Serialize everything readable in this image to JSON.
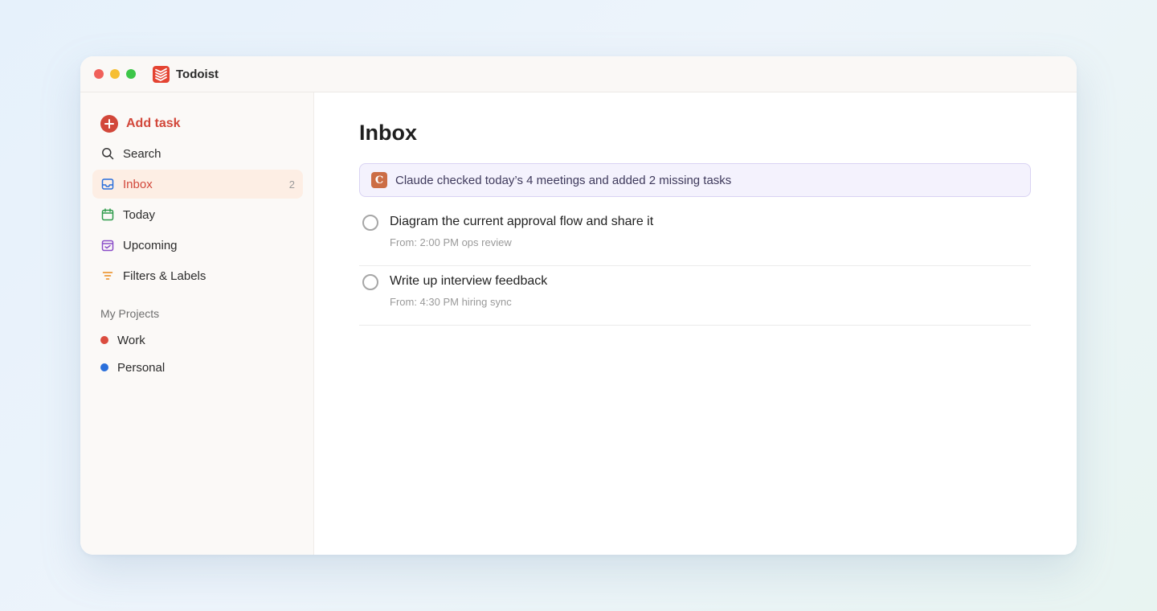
{
  "window": {
    "app_name": "Todoist",
    "colors": {
      "accent": "#d2473a",
      "traffic_red": "#f0605a",
      "traffic_yellow": "#f6be33",
      "traffic_green": "#3cc648"
    }
  },
  "sidebar": {
    "add_task": {
      "label": "Add task",
      "icon": "plus-circle-icon"
    },
    "items": [
      {
        "label": "Search",
        "icon": "search-icon"
      },
      {
        "label": "Inbox",
        "icon": "inbox-icon",
        "count": "2",
        "active": true
      },
      {
        "label": "Today",
        "icon": "calendar-icon"
      },
      {
        "label": "Upcoming",
        "icon": "calendar-upcoming-icon"
      },
      {
        "label": "Filters & Labels",
        "icon": "filter-icon"
      }
    ],
    "projects_heading": "My Projects",
    "projects": [
      {
        "label": "Work",
        "color": "#db4c3f"
      },
      {
        "label": "Personal",
        "color": "#2a6fdb"
      }
    ]
  },
  "main": {
    "title": "Inbox",
    "banner": {
      "badge": "C",
      "text": "Claude checked today’s 4 meetings and added 2 missing tasks"
    },
    "tasks": [
      {
        "title": "Diagram the current approval flow and share it",
        "meta": "From: 2:00 PM ops review"
      },
      {
        "title": "Write up interview feedback",
        "meta": "From: 4:30 PM hiring sync"
      }
    ]
  }
}
